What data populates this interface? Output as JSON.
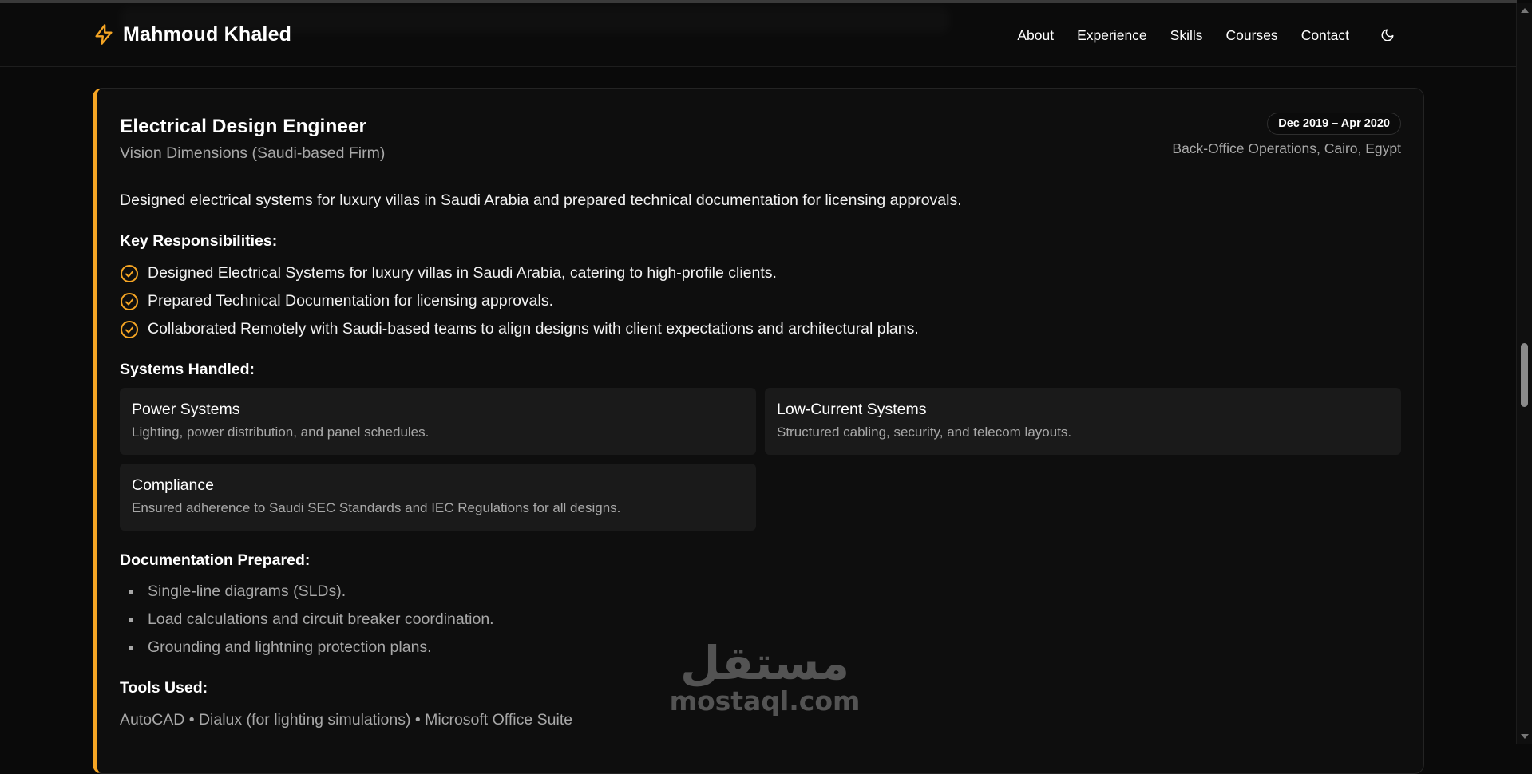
{
  "brand": {
    "title": "Mahmoud Khaled",
    "icon": "lightning-bolt-icon",
    "accent": "#f5a524"
  },
  "nav": {
    "items": [
      "About",
      "Experience",
      "Skills",
      "Courses",
      "Contact"
    ],
    "theme_toggle_icon": "moon-icon"
  },
  "experience": {
    "title": "Electrical Design Engineer",
    "company": "Vision Dimensions (Saudi-based Firm)",
    "dates": "Dec 2019 – Apr 2020",
    "location": "Back-Office Operations, Cairo, Egypt",
    "summary": "Designed electrical systems for luxury villas in Saudi Arabia and prepared technical documentation for licensing approvals.",
    "responsibilities_heading": "Key Responsibilities:",
    "responsibilities": [
      "Designed Electrical Systems for luxury villas in Saudi Arabia, catering to high-profile clients.",
      "Prepared Technical Documentation for licensing approvals.",
      "Collaborated Remotely with Saudi-based teams to align designs with client expectations and architectural plans."
    ],
    "systems_heading": "Systems Handled:",
    "systems": [
      {
        "title": "Power Systems",
        "desc": "Lighting, power distribution, and panel schedules."
      },
      {
        "title": "Low-Current Systems",
        "desc": "Structured cabling, security, and telecom layouts."
      },
      {
        "title": "Compliance",
        "desc": "Ensured adherence to Saudi SEC Standards and IEC Regulations for all designs."
      }
    ],
    "documentation_heading": "Documentation Prepared:",
    "documentation": [
      "Single-line diagrams (SLDs).",
      "Load calculations and circuit breaker coordination.",
      "Grounding and lightning protection plans."
    ],
    "tools_heading": "Tools Used:",
    "tools": "AutoCAD • Dialux (for lighting simulations) • Microsoft Office Suite"
  },
  "watermark": {
    "arabic": "مستقل",
    "latin": "mostaql.com"
  }
}
